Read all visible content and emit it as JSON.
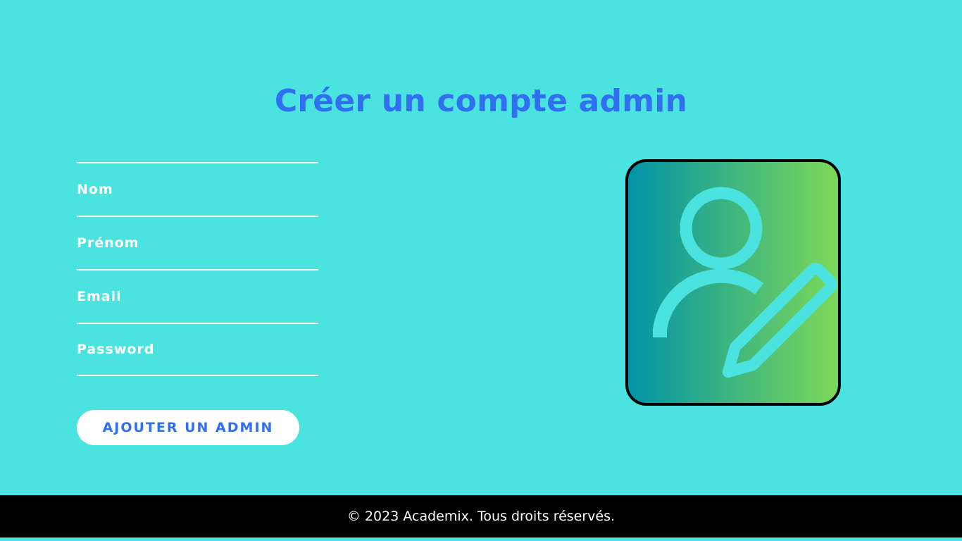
{
  "page": {
    "title": "Créer un compte admin"
  },
  "form": {
    "fields": [
      {
        "name": "nom",
        "placeholder": "Nom",
        "value": ""
      },
      {
        "name": "prenom",
        "placeholder": "Prénom",
        "value": ""
      },
      {
        "name": "email",
        "placeholder": "Email",
        "value": ""
      },
      {
        "name": "password",
        "placeholder": "Password",
        "value": ""
      }
    ],
    "submit_label": "AJOUTER UN ADMIN"
  },
  "illustration": {
    "icon": "user-edit-icon"
  },
  "footer": {
    "text": "© 2023 Academix. Tous droits réservés."
  },
  "colors": {
    "background": "#4be3e0",
    "accent": "#2f6ff0",
    "gradient_start": "#0093a8",
    "gradient_end": "#7ed957",
    "footer_bg": "#000000"
  }
}
